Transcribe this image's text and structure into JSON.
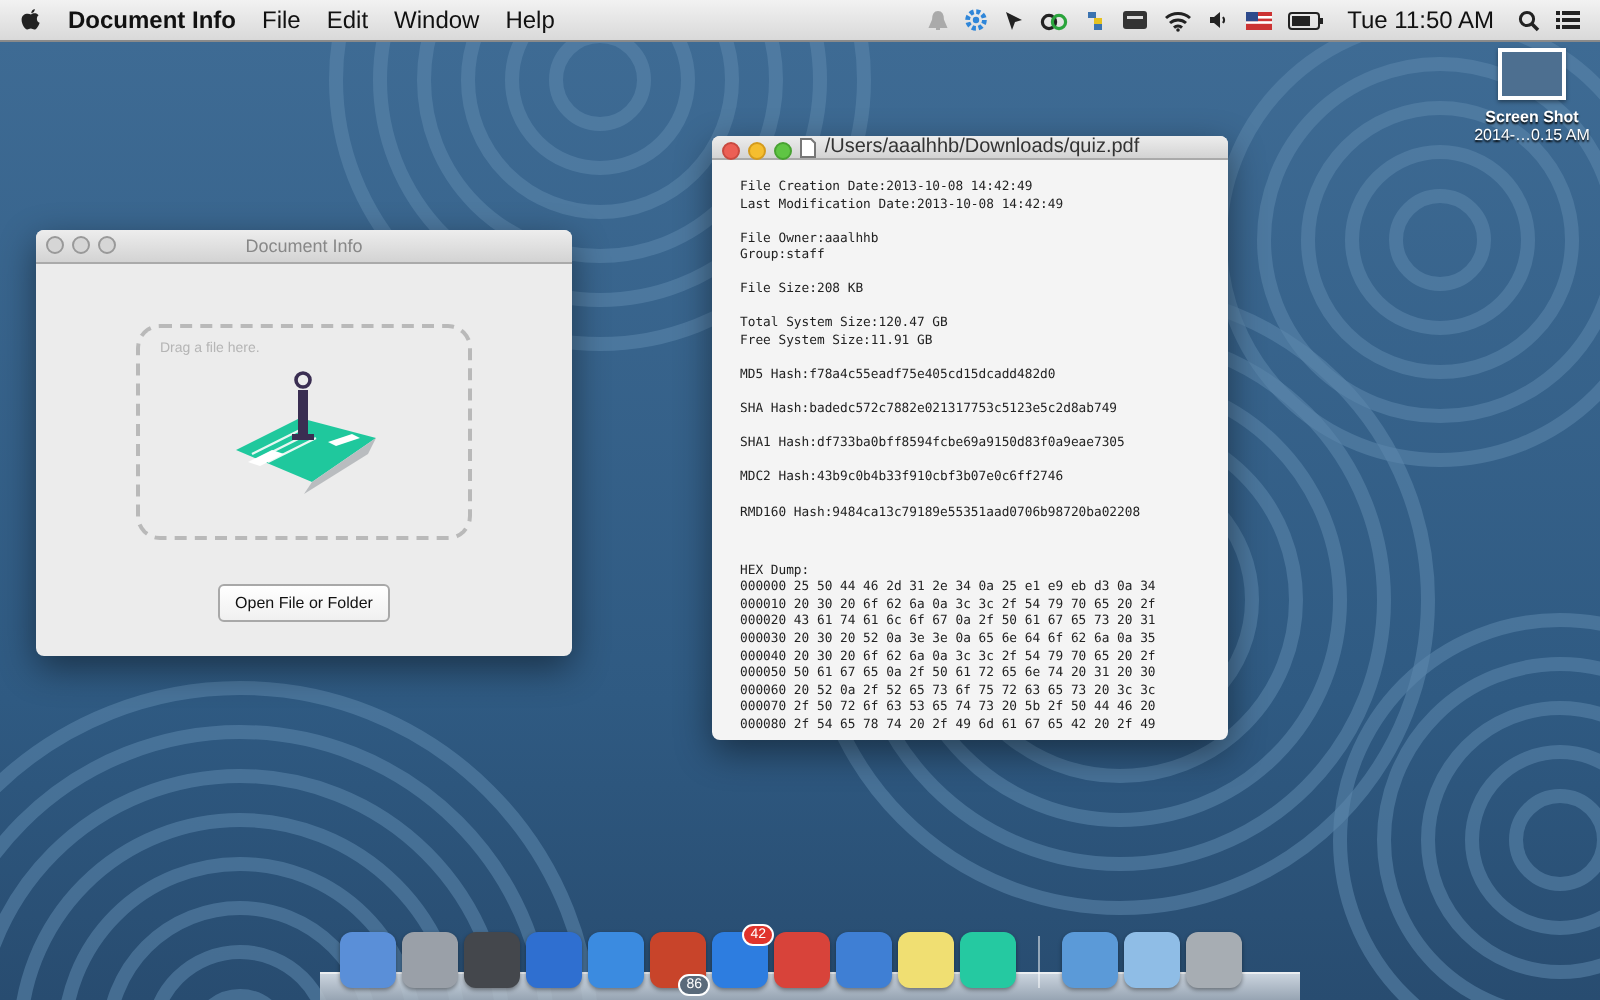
{
  "menu_bar": {
    "app_name": "Document Info",
    "menus": [
      "File",
      "Edit",
      "Window",
      "Help"
    ],
    "clock": "Tue 11:50 AM"
  },
  "desktop_icon": {
    "label_lines": [
      "Screen Shot",
      "2014-…0.15 AM"
    ]
  },
  "doc_window": {
    "title": "Document Info",
    "active": false,
    "drop_hint": "Drag a file here.",
    "button": "Open File or Folder"
  },
  "file_window": {
    "title": "/Users/aaalhhb/Downloads/quiz.pdf",
    "active": true,
    "sections": [
      [
        "File Creation Date:2013-10-08 14:42:49",
        "Last Modification Date:2013-10-08 14:42:49"
      ],
      [
        "File Owner:aaalhhb",
        "Group:staff"
      ],
      [
        "File Size:208 KB"
      ],
      [
        "Total System Size:120.47 GB",
        "Free System Size:11.91 GB"
      ],
      [
        "MD5 Hash:f78a4c55eadf75e405cd15dcadd482d0"
      ],
      [
        "SHA Hash:badedc572c7882e021317753c5123e5c2d8ab749"
      ],
      [
        "SHA1 Hash:df733ba0bff8594fcbe69a9150d83f0a9eae7305"
      ],
      [
        "MDC2 Hash:43b9c0b4b33f910cbf3b07e0c6ff2746"
      ],
      [
        "RMD160 Hash:9484ca13c79189e55351aad0706b98720ba02208"
      ]
    ],
    "hex_title": "HEX Dump:",
    "hex_rows": [
      "000000 25 50 44 46 2d 31 2e 34 0a 25 e1 e9 eb d3 0a 34",
      "000010 20 30 20 6f 62 6a 0a 3c 3c 2f 54 79 70 65 20 2f",
      "000020 43 61 74 61 6c 6f 67 0a 2f 50 61 67 65 73 20 31",
      "000030 20 30 20 52 0a 3e 3e 0a 65 6e 64 6f 62 6a 0a 35",
      "000040 20 30 20 6f 62 6a 0a 3c 3c 2f 54 79 70 65 20 2f",
      "000050 50 61 67 65 0a 2f 50 61 72 65 6e 74 20 31 20 30",
      "000060 20 52 0a 2f 52 65 73 6f 75 72 63 65 73 20 3c 3c",
      "000070 2f 50 72 6f 63 53 65 74 73 20 5b 2f 50 44 46 20",
      "000080 2f 54 65 78 74 20 2f 49 6d 61 67 65 42 20 2f 49"
    ]
  },
  "dock": {
    "badges": [
      "86",
      "42"
    ]
  }
}
